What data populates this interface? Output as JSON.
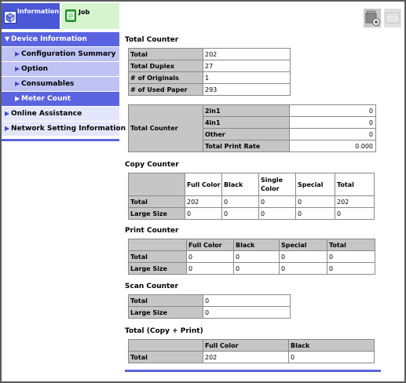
{
  "tabs": {
    "information": "Information",
    "job": "Job"
  },
  "sidebar": {
    "items": [
      {
        "label": "Device Information",
        "arrow": "▼"
      },
      {
        "label": "Configuration Summary",
        "arrow": "▶"
      },
      {
        "label": "Option",
        "arrow": "▶"
      },
      {
        "label": "Consumables",
        "arrow": "▶"
      },
      {
        "label": "Meter Count",
        "arrow": "▶"
      },
      {
        "label": "Online Assistance",
        "arrow": "▶"
      },
      {
        "label": "Network Setting Information",
        "arrow": "▶"
      }
    ]
  },
  "total_counter": {
    "title": "Total Counter",
    "rows": [
      {
        "label": "Total",
        "value": "202"
      },
      {
        "label": "Total Duplex",
        "value": "27"
      },
      {
        "label": "# of Originals",
        "value": "1"
      },
      {
        "label": "# of Used Paper",
        "value": "293"
      }
    ],
    "sub_label": "Total Counter",
    "sub_rows": [
      {
        "label": "2in1",
        "value": "0"
      },
      {
        "label": "4in1",
        "value": "0"
      },
      {
        "label": "Other",
        "value": "0"
      },
      {
        "label": "Total Print Rate",
        "value": "0.000"
      }
    ]
  },
  "copy_counter": {
    "title": "Copy Counter",
    "headers": [
      "Full Color",
      "Black",
      "Single Color",
      "Special",
      "Total"
    ],
    "rows": [
      {
        "label": "Total",
        "values": [
          "202",
          "0",
          "0",
          "0",
          "202"
        ]
      },
      {
        "label": "Large Size",
        "values": [
          "0",
          "0",
          "0",
          "0",
          "0"
        ]
      }
    ]
  },
  "print_counter": {
    "title": "Print Counter",
    "headers": [
      "Full Color",
      "Black",
      "Special",
      "Total"
    ],
    "rows": [
      {
        "label": "Total",
        "values": [
          "0",
          "0",
          "0",
          "0"
        ]
      },
      {
        "label": "Large Size",
        "values": [
          "0",
          "0",
          "0",
          "0"
        ]
      }
    ]
  },
  "scan_counter": {
    "title": "Scan Counter",
    "rows": [
      {
        "label": "Total",
        "value": "0"
      },
      {
        "label": "Large Size",
        "value": "0"
      }
    ]
  },
  "total_copy_print": {
    "title": "Total (Copy + Print)",
    "headers": [
      "Full Color",
      "Black"
    ],
    "rows": [
      {
        "label": "Total",
        "values": [
          "202",
          "0"
        ]
      }
    ]
  },
  "colors": {
    "accent": "#5a64e0",
    "info_tab": "#4a58d6",
    "job_tab": "#d6f5cf",
    "header_cell": "#c6c6c6"
  },
  "icons": [
    "information-icon",
    "job-icon",
    "device-status-icon",
    "panel-icon"
  ]
}
